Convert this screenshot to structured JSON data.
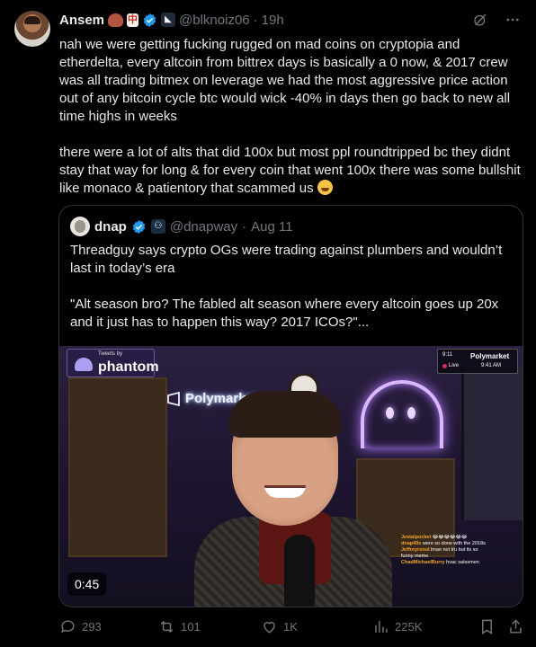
{
  "author": {
    "name": "Ansem",
    "handle": "@blknoiz06",
    "separator": "·",
    "time": "19h"
  },
  "post": {
    "paragraphs": [
      "nah we were getting fucking rugged on mad coins on cryptopia and etherdelta, every altcoin from bittrex days is basically a 0 now, & 2017 crew was all trading bitmex on leverage we had the most aggressive price action out of any bitcoin cycle btc would wick -40% in days then go back to new all time highs in weeks",
      "there were a lot of alts that did 100x but most ppl roundtripped bc they didnt stay that way for long & for every coin that went 100x there was some bullshit like monaco & patientory that scammed us"
    ]
  },
  "quote": {
    "name": "dnap",
    "handle": "@dnapway",
    "separator": "·",
    "date": "Aug 11",
    "paragraphs": [
      "Threadguy says crypto OGs were trading against plumbers and wouldn’t last in today’s era",
      "\"Alt season bro? The fabled alt season where every altcoin goes up 20x and it just has to happen this way? 2017 ICOs?\"..."
    ],
    "video": {
      "duration": "0:45",
      "sponsor_small": "Tweets by",
      "sponsor_name": "phantom",
      "sign_text": "Polymarket",
      "live_brand": "Polymarket",
      "live_label": "Live",
      "live_time_a": "9:11",
      "live_clock": "9:41 AM",
      "chat": [
        {
          "user": "Jestalpocket",
          "msg": "😂😂😂😂😂😂"
        },
        {
          "user": "dnap40s",
          "msg": "were so done with the 2018s"
        },
        {
          "user": "Jeffreyrsoul",
          "msg": "lmao not tru but its so"
        },
        {
          "user": "",
          "msg": "funny meme"
        },
        {
          "user": "ChadMichaelBurry",
          "msg": "hvac salesmen"
        }
      ]
    }
  },
  "actions": {
    "replies": "293",
    "reposts": "101",
    "likes": "1K",
    "views": "225K"
  }
}
